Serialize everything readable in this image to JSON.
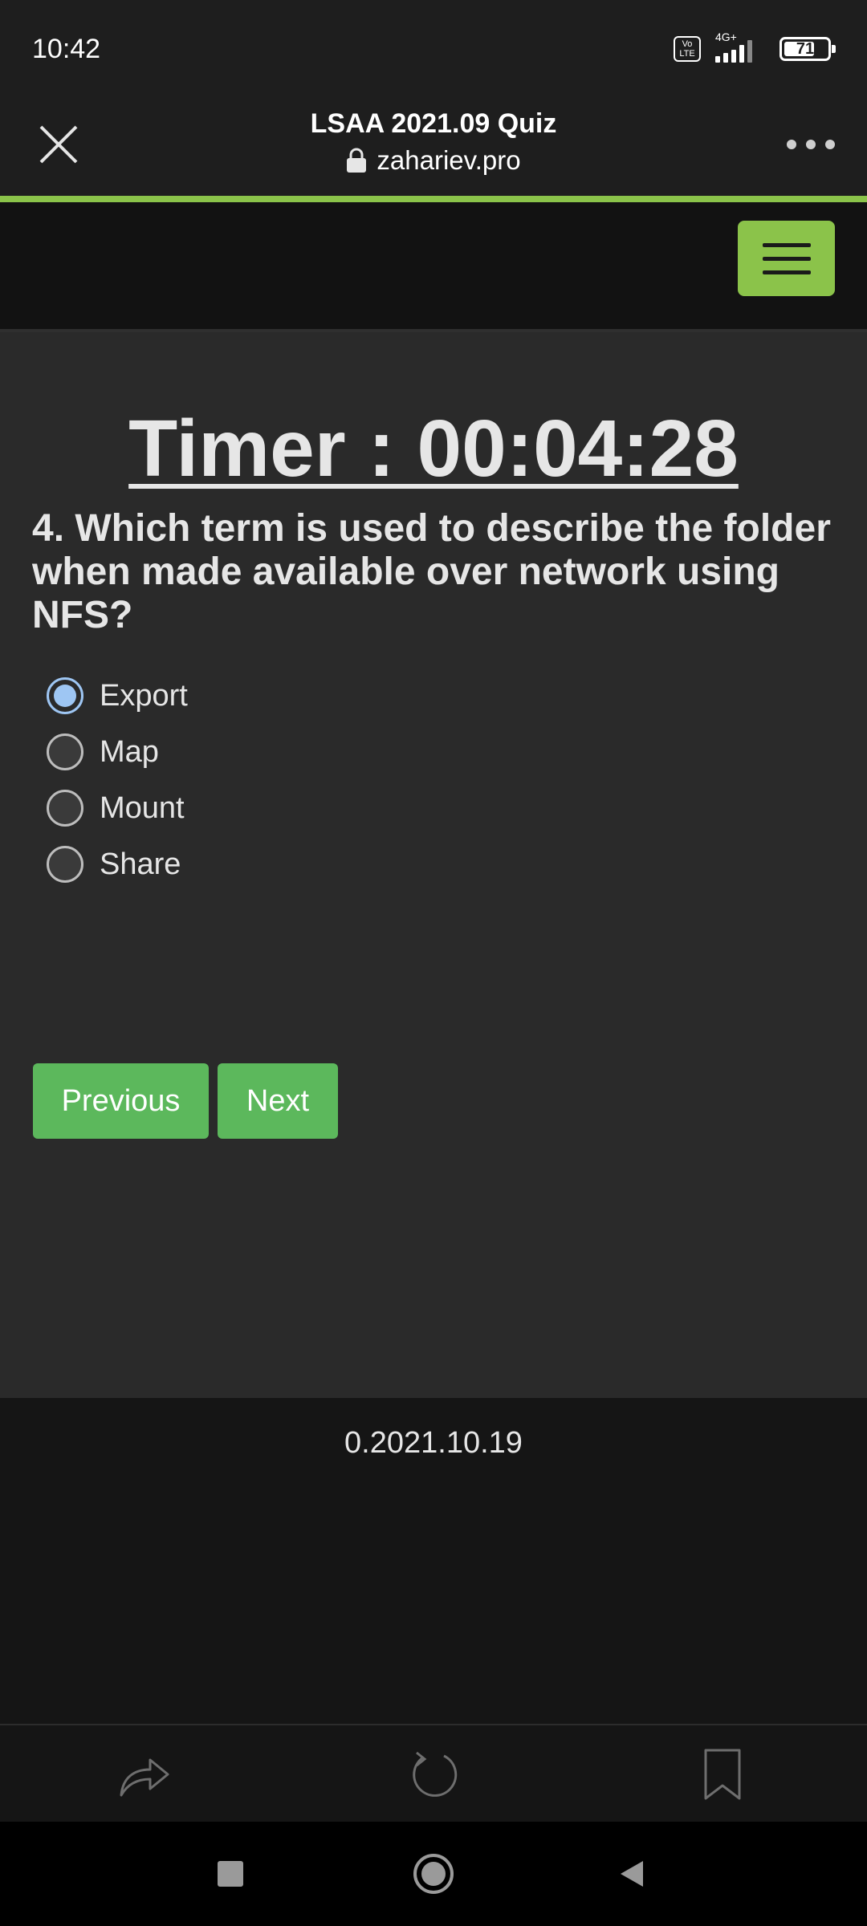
{
  "status_bar": {
    "time": "10:42",
    "volte": "Vo LTE",
    "network": "4G+",
    "battery_percent": "71",
    "battery_level": 0.71
  },
  "browser": {
    "title": "LSAA 2021.09 Quiz",
    "url": "zahariev.pro",
    "icons": {
      "close": "close-icon",
      "lock": "lock-icon",
      "more": "more-icon"
    },
    "accent_color": "#8bc34a"
  },
  "quiz": {
    "timer": "Timer : 00:04:28",
    "question": "4. Which term is used to describe the folder when made available over network using NFS?",
    "options": [
      {
        "label": "Export",
        "selected": true
      },
      {
        "label": "Map",
        "selected": false
      },
      {
        "label": "Mount",
        "selected": false
      },
      {
        "label": "Share",
        "selected": false
      }
    ],
    "buttons": {
      "previous": "Previous",
      "next": "Next"
    },
    "button_color": "#5cb85c"
  },
  "footer": {
    "version": "0.2021.10.19"
  },
  "toolbar": {
    "icons": [
      "share-icon",
      "refresh-icon",
      "bookmark-icon"
    ]
  },
  "android_nav": {
    "icons": [
      "recents-icon",
      "home-icon",
      "back-icon"
    ]
  }
}
